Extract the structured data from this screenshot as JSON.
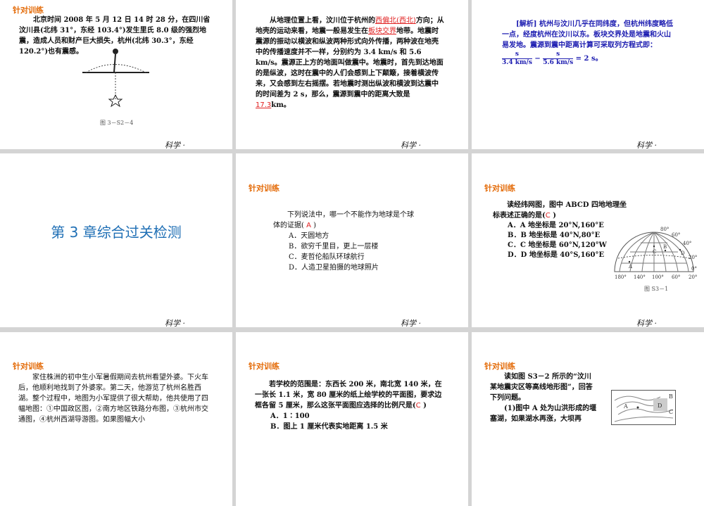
{
  "footer": "科学 ·",
  "section_title": "针对训练",
  "slides": [
    {
      "text": "北京时间 2008 年 5 月 12 日 14 时 28 分，在四川省汶川县(北纬 31°，东经 103.4°)发生里氏 8.0 级的强烈地震，造成人员和财产巨大损失，杭州(北纬 30.3°，东经 120.2°)也有震感。",
      "caption": "图 3－S2－4"
    },
    {
      "p1": "从地理位置上看，汶川位于杭州的",
      "a1": "西偏北(西北)",
      "p2": "方向；从地壳的运动来看，地震一般易发生在",
      "a2": "板块交界",
      "p3": "地带。地震时震源的振动以横波和纵波两种形式向外传播，两种波在地壳中的传播速度并不一样，分别约为 3.4 km/s 和 5.6 km/s。震源正上方的地面叫做震中。地震时，首先到达地面的是纵波，这时在震中的人们会感到上下颠簸，接着横波传来，又会感到左右摇摆。若地震时测出纵波和横波到达震中的时间差为 2 s，那么，震源到震中的距离大致是",
      "a3": "17.3",
      "p4": "km。"
    },
    {
      "label": "[解析]",
      "text": "杭州与汶川几乎在同纬度，但杭州纬度略低一点，经度杭州在汶川以东。板块交界处是地震和火山易发地。震源到震中距离计算可采取列方程式即：",
      "num": "s",
      "den1": "3.4 km/s",
      "den2": "5.6 km/s",
      "result": "= 2 s。"
    },
    {
      "title": "第 3 章综合过关检测"
    },
    {
      "q": "下列说法中，哪一个不能作为地球是个球体的证据(",
      "ans": "A",
      "close": ")",
      "options": [
        "A．天圆地方",
        "B．欲穷千里目，更上一层楼",
        "C．麦哲伦船队环球航行",
        "D．人造卫星拍摄的地球照片"
      ]
    },
    {
      "q": "读经纬网图，图中 ABCD 四地地理坐标表述正确的是(",
      "ans": "C",
      "close": ")",
      "options": [
        "A．A 地坐标是 20°N,160°E",
        "B．B 地坐标是 40°N,80°E",
        "C．C 地坐标是 60°N,120°W",
        "D．D 地坐标是 40°S,160°E"
      ],
      "map_lon": [
        "180°",
        "140°",
        "100°",
        "60°",
        "20°"
      ],
      "map_lat": [
        "80°",
        "60°",
        "40°",
        "20°",
        "0°"
      ],
      "map_points": [
        "A",
        "B",
        "C",
        "D"
      ],
      "caption": "图 S3－1"
    },
    {
      "text": "家住株洲的初中生小军暑假期间去杭州看望外婆。下火车后，他顺利地找到了外婆家。第二天，他游览了杭州名胜西湖。整个过程中，地图为小军提供了很大帮助，他共使用了四幅地图：①中国政区图，②南方地区铁路分布图，③杭州市交通图，④杭州西湖导游图。如果图幅大小"
    },
    {
      "q": "若学校的范围是：东西长 200 米，南北宽 140 米，在一张长 1.1 米，宽 80 厘米的纸上绘学校的平面图，要求边框各留 5 厘米，那么这张平面图应选择的比例尺是(",
      "ans": "C",
      "close": ")",
      "options": [
        "A．1∶100",
        "B．图上 1 厘米代表实地距离 1.5 米"
      ]
    },
    {
      "text": "读如图 S3－2 所示的“汶川某地震灾区等高线地形图”，回答下列问题。",
      "q1": "(1)图中 A 处为山洪形成的堰塞湖，如果湖水再涨，大坝再",
      "map_labels": [
        "A",
        "B",
        "C",
        "D"
      ]
    }
  ]
}
